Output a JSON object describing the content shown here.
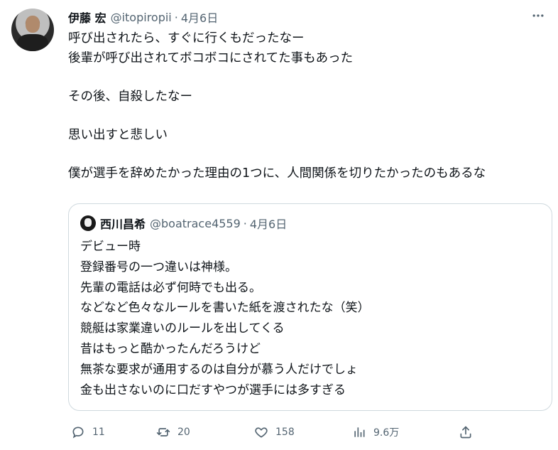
{
  "tweet": {
    "author_name": "伊藤 宏",
    "handle": "@itopiropii",
    "separator": "·",
    "date": "4月6日",
    "more_icon": "more-horizontal-icon",
    "lines": [
      "呼び出されたら、すぐに行くもだったなー",
      "後輩が呼び出されてボコボコにされてた事もあった",
      "その後、自殺したなー",
      "思い出すと悲しい",
      "僕が選手を辞めたかった理由の1つに、人間関係を切りたかったのもあるな"
    ]
  },
  "quote": {
    "author_name": "西川昌希",
    "handle": "@boatrace4559",
    "separator": "·",
    "date": "4月6日",
    "lines": [
      "デビュー時",
      "登録番号の一つ違いは神様。",
      "先輩の電話は必ず何時でも出る。",
      "などなど色々なルールを書いた紙を渡されたな（笑）",
      "競艇は家業違いのルールを出してくる",
      "昔はもっと酷かったんだろうけど",
      "無茶な要求が通用するのは自分が慕う人だけでしょ",
      "金も出さないのに口だすやつが選手には多すぎる"
    ]
  },
  "actions": {
    "reply": {
      "icon": "reply-icon",
      "count": "11"
    },
    "retweet": {
      "icon": "retweet-icon",
      "count": "20"
    },
    "like": {
      "icon": "heart-icon",
      "count": "158"
    },
    "views": {
      "icon": "views-chart-icon",
      "count": "9.6万"
    },
    "share": {
      "icon": "share-icon"
    }
  },
  "colors": {
    "text": "#0f1419",
    "secondary": "#536471",
    "border": "#cfd9de"
  }
}
